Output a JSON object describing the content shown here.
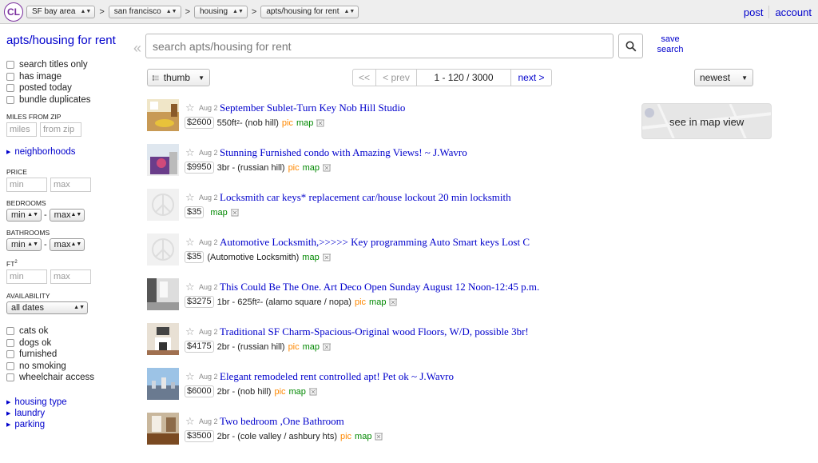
{
  "topbar": {
    "logo": "CL",
    "crumbs": [
      "SF bay area",
      "san francisco",
      "housing",
      "apts/housing for rent"
    ],
    "crumb_sep": ">",
    "post_label": "post",
    "account_label": "account"
  },
  "sidebar": {
    "title": "apts/housing for rent",
    "top_checks": [
      "search titles only",
      "has image",
      "posted today",
      "bundle duplicates"
    ],
    "miles_label": "MILES FROM ZIP",
    "miles_placeholder": "miles",
    "zip_placeholder": "from zip",
    "neighborhoods_label": "neighborhoods",
    "price_label": "PRICE",
    "min_placeholder": "min",
    "max_placeholder": "max",
    "bedrooms_label": "BEDROOMS",
    "bathrooms_label": "BATHROOMS",
    "sel_min": "min",
    "sel_max": "max",
    "dash": "-",
    "ft_label": "FT",
    "ft_sup": "2",
    "availability_label": "AVAILABILITY",
    "availability_value": "all dates",
    "bottom_checks": [
      "cats ok",
      "dogs ok",
      "furnished",
      "no smoking",
      "wheelchair access"
    ],
    "bottom_links": [
      "housing type",
      "laundry",
      "parking"
    ]
  },
  "search": {
    "placeholder": "search apts/housing for rent",
    "save_label": "save search"
  },
  "toolbar": {
    "view_label": "thumb",
    "pager_first": "<<",
    "pager_prev": "< prev",
    "pager_range": "1 - 120 / 3000",
    "pager_next": "next >",
    "sort_label": "newest"
  },
  "map_view_label": "see in map view",
  "results": [
    {
      "date": "Aug 2",
      "title": "September Sublet-Turn Key Nob Hill Studio",
      "price": "$2600",
      "pre": "550ft",
      "sup": "2",
      "post": " - (nob hill)",
      "pic": "pic",
      "map": "map",
      "thumb": "room"
    },
    {
      "date": "Aug 2",
      "title": "Stunning Furnished condo with Amazing Views! ~ J.Wavro",
      "price": "$9950",
      "pre": "3br - (russian hill)",
      "sup": "",
      "post": "",
      "pic": "pic",
      "map": "map",
      "thumb": "view"
    },
    {
      "date": "Aug 2",
      "title": "Locksmith car keys* replacement car/house lockout 20 min locksmith",
      "price": "$35",
      "pre": "",
      "sup": "",
      "post": "",
      "pic": "",
      "map": "map",
      "thumb": "placeholder"
    },
    {
      "date": "Aug 2",
      "title": "Automotive Locksmith,>>>>> Key programming Auto Smart keys Lost C",
      "price": "$35",
      "pre": "(Automotive Locksmith)",
      "sup": "",
      "post": "",
      "pic": "",
      "map": "map",
      "thumb": "placeholder"
    },
    {
      "date": "Aug 2",
      "title": "This Could Be The One. Art Deco Open Sunday August 12 Noon-12:45 p.m.",
      "price": "$3275",
      "pre": "1br - 625ft",
      "sup": "2",
      "post": " - (alamo square / nopa)",
      "pic": "pic",
      "map": "map",
      "thumb": "interior"
    },
    {
      "date": "Aug 2",
      "title": "Traditional SF Charm-Spacious-Original wood Floors, W/D, possible 3br!",
      "price": "$4175",
      "pre": "2br - (russian hill)",
      "sup": "",
      "post": "",
      "pic": "pic",
      "map": "map",
      "thumb": "fireplace"
    },
    {
      "date": "Aug 2",
      "title": "Elegant remodeled rent controlled apt! Pet ok ~ J.Wavro",
      "price": "$6000",
      "pre": "2br - (nob hill)",
      "sup": "",
      "post": "",
      "pic": "pic",
      "map": "map",
      "thumb": "city"
    },
    {
      "date": "Aug 2",
      "title": "Two bedroom ,One Bathroom",
      "price": "$3500",
      "pre": "2br - (cole valley / ashbury hts)",
      "sup": "",
      "post": "",
      "pic": "pic",
      "map": "map",
      "thumb": "wood"
    }
  ]
}
